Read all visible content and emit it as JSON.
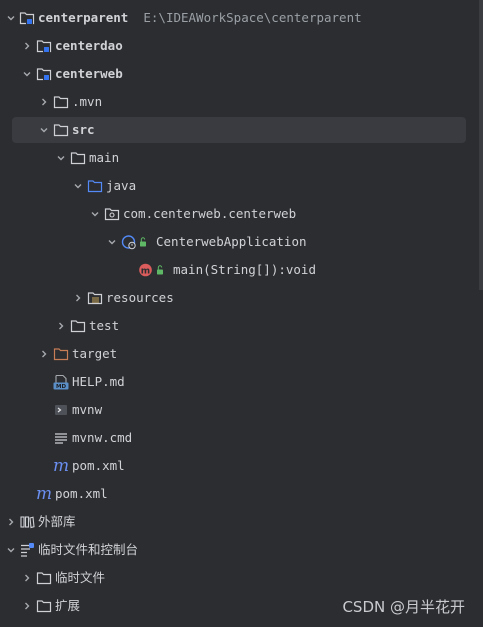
{
  "tree": {
    "root": {
      "label": "centerparent",
      "path": "E:\\IDEAWorkSpace\\centerparent"
    },
    "centerdao": "centerdao",
    "centerweb": "centerweb",
    "mvn": ".mvn",
    "src": "src",
    "main": "main",
    "java": "java",
    "package": "com.centerweb.centerweb",
    "app_class": "CenterwebApplication",
    "main_method": "main(String[]):void",
    "resources": "resources",
    "test": "test",
    "target": "target",
    "help_md": "HELP.md",
    "mvnw": "mvnw",
    "mvnw_cmd": "mvnw.cmd",
    "web_pom": "pom.xml",
    "root_pom": "pom.xml",
    "external_libs": "外部库",
    "scratches": "临时文件和控制台",
    "scratch_files": "临时文件",
    "extensions": "扩展"
  },
  "watermark": "CSDN @月半花开",
  "colors": {
    "background": "#2b2d30",
    "selection": "#393b40",
    "folder_blue": "#548af7",
    "target_orange": "#c77d55",
    "method_red": "#db5c5c",
    "lock_green": "#5fb865"
  }
}
